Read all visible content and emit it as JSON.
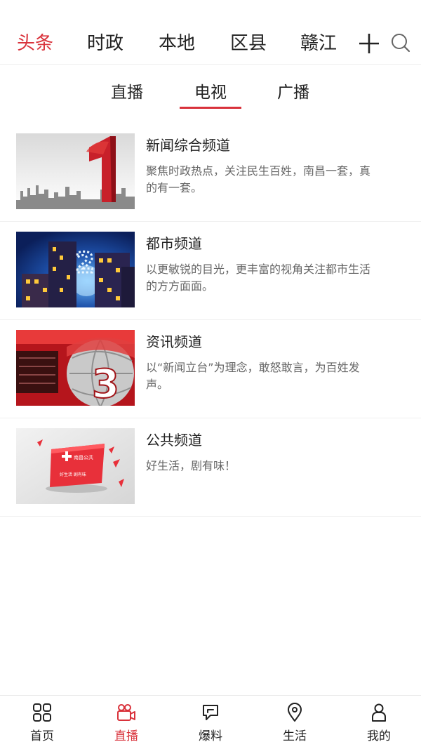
{
  "topnav": {
    "categories": [
      {
        "label": "头条",
        "active": true
      },
      {
        "label": "时政"
      },
      {
        "label": "本地"
      },
      {
        "label": "区县"
      },
      {
        "label": "赣江"
      }
    ],
    "add_icon": "plus-icon",
    "search_icon": "search-icon"
  },
  "subtabs": {
    "items": [
      {
        "label": "直播"
      },
      {
        "label": "电视",
        "active": true
      },
      {
        "label": "广播"
      }
    ]
  },
  "channels": [
    {
      "title": "新闻综合频道",
      "desc": "聚焦时政热点，关注民生百姓，南昌一套，真的有一套。"
    },
    {
      "title": "都市频道",
      "desc": "以更敏锐的目光，更丰富的视角关注都市生活的方方面面。"
    },
    {
      "title": "资讯频道",
      "desc": "以“新闻立台”为理念，敢怒敢言，为百姓发声。"
    },
    {
      "title": "公共频道",
      "desc": "好生活，剧有味！"
    }
  ],
  "thumbs": {
    "ch4_logo_text": "南昌公共",
    "ch4_slogan": "好生活 剧有味"
  },
  "bottomnav": {
    "items": [
      {
        "label": "首页",
        "icon": "grid-icon"
      },
      {
        "label": "直播",
        "icon": "video-camera-icon",
        "active": true
      },
      {
        "label": "爆料",
        "icon": "chat-bubble-icon"
      },
      {
        "label": "生活",
        "icon": "location-pin-icon"
      },
      {
        "label": "我的",
        "icon": "person-icon"
      }
    ]
  },
  "colors": {
    "accent": "#d9323b",
    "text": "#222222",
    "muted": "#666666"
  }
}
